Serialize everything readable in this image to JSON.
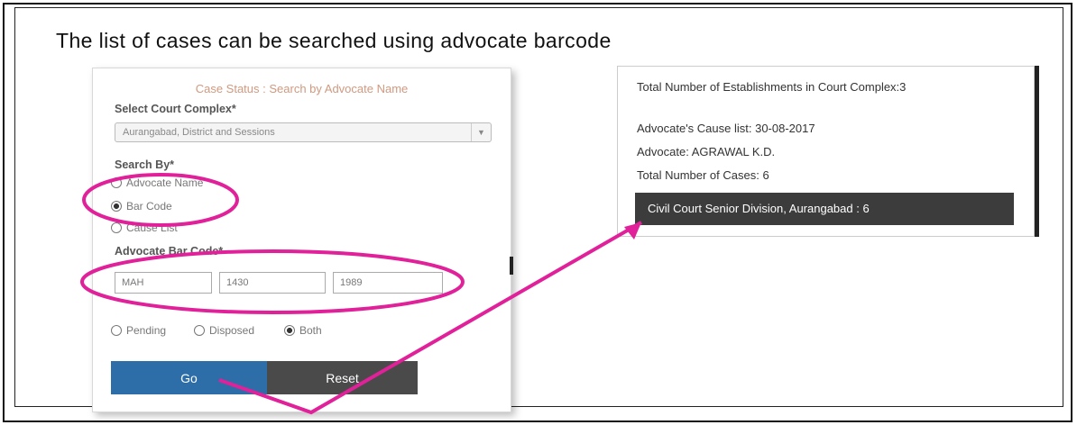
{
  "caption": "The list of cases can be searched using advocate barcode",
  "form": {
    "title": "Case Status : Search by Advocate Name",
    "court_label": "Select Court Complex*",
    "court_value": "Aurangabad, District and Sessions",
    "search_by_label": "Search By*",
    "search_options": [
      "Advocate Name",
      "Bar Code",
      "Cause List"
    ],
    "bar_code_label": "Advocate Bar Code*",
    "bar_code_parts": [
      "MAH",
      "1430",
      "1989"
    ],
    "status_options": [
      "Pending",
      "Disposed",
      "Both"
    ],
    "go_label": "Go",
    "reset_label": "Reset"
  },
  "result": {
    "establishments": "Total Number of Establishments in Court Complex:3",
    "cause_list": "Advocate's Cause list: 30-08-2017",
    "advocate": "Advocate: AGRAWAL K.D.",
    "total_cases": "Total Number of Cases: 6",
    "court_entry": "Civil Court Senior Division, Aurangabad : 6"
  },
  "colors": {
    "highlight": "#e0219a",
    "go_button": "#2d6da8",
    "reset_button": "#4a4a4a",
    "result_bar": "#3c3c3c"
  }
}
